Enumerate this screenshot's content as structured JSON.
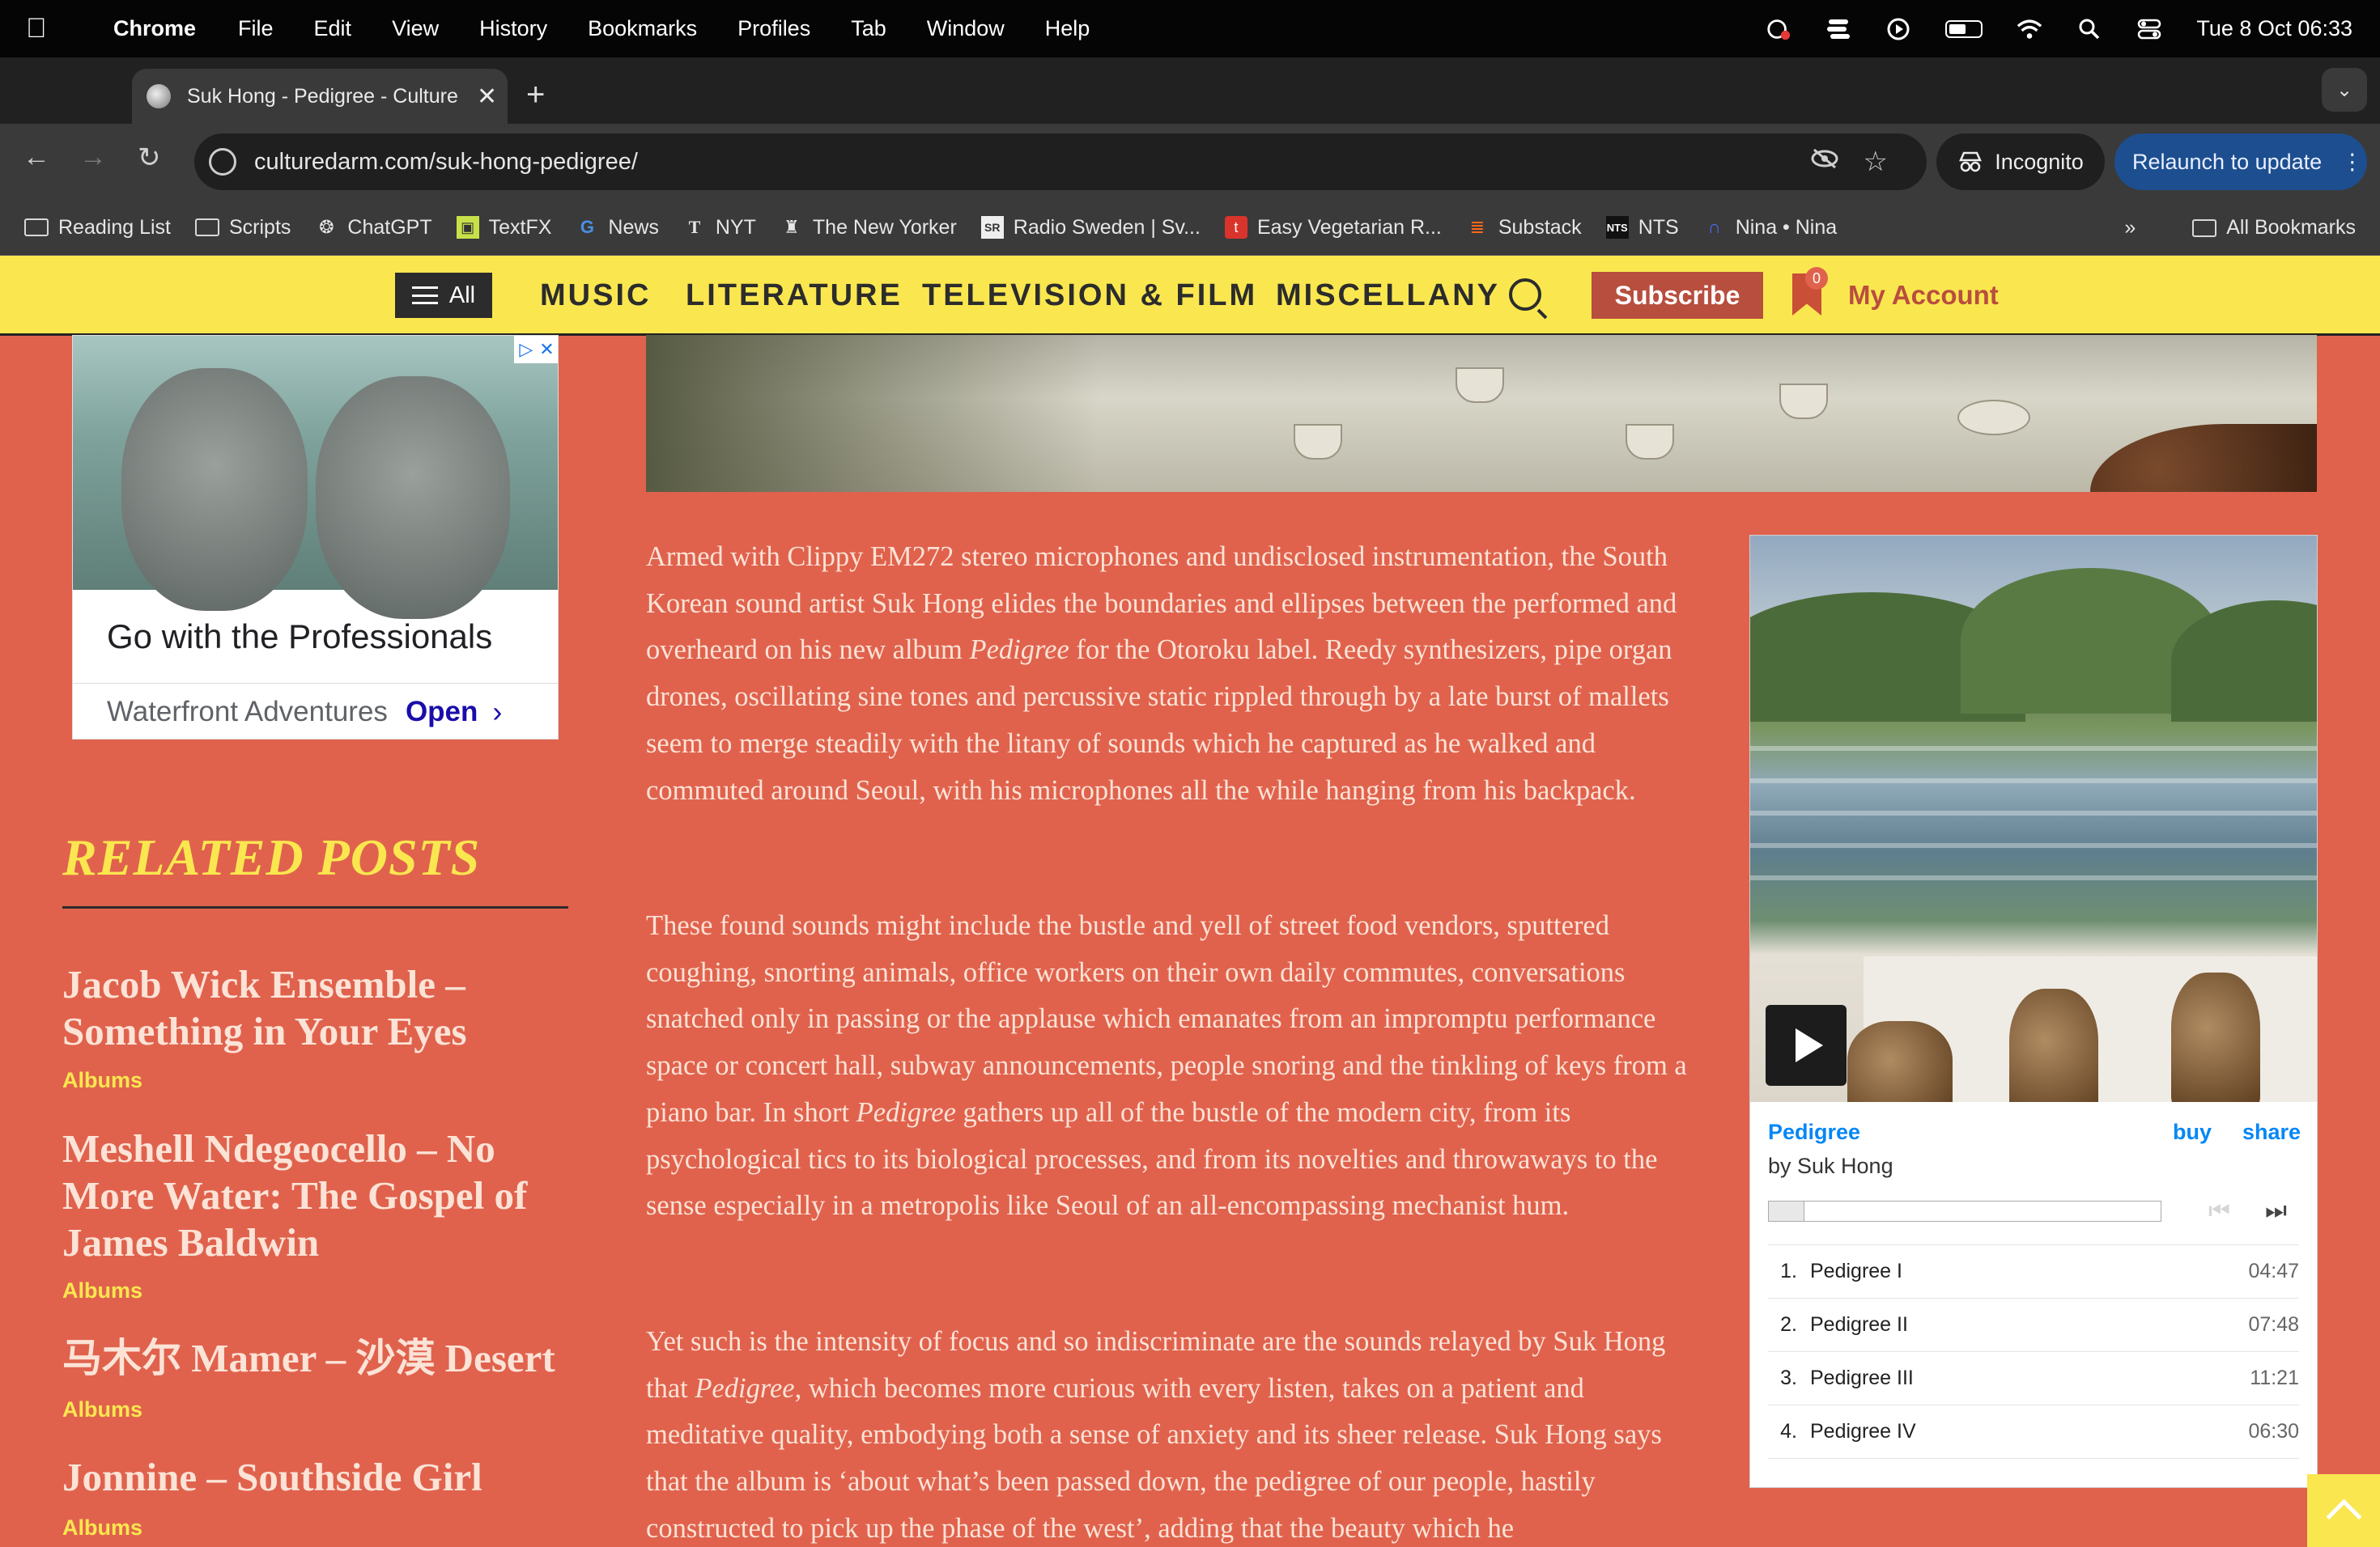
{
  "menubar": {
    "app": "Chrome",
    "items": [
      "File",
      "Edit",
      "View",
      "History",
      "Bookmarks",
      "Profiles",
      "Tab",
      "Window",
      "Help"
    ],
    "clock": "Tue 8 Oct  06:33"
  },
  "tab": {
    "title": "Suk Hong - Pedigree - Culture Dar",
    "new_tab": "+"
  },
  "toolbar": {
    "url": "culturedarm.com/suk-hong-pedigree/",
    "incognito": "Incognito",
    "relaunch": "Relaunch to update"
  },
  "bookmarks": {
    "items": [
      {
        "label": "Reading List",
        "icon": "folder-icon"
      },
      {
        "label": "Scripts",
        "icon": "folder-icon"
      },
      {
        "label": "ChatGPT",
        "icon": "chatgpt-icon"
      },
      {
        "label": "TextFX",
        "icon": "textfx-icon"
      },
      {
        "label": "News",
        "icon": "google-icon"
      },
      {
        "label": "NYT",
        "icon": "nyt-icon"
      },
      {
        "label": "The New Yorker",
        "icon": "new-yorker-icon"
      },
      {
        "label": "Radio Sweden | Sv...",
        "icon": "sr-icon"
      },
      {
        "label": "Easy Vegetarian R...",
        "icon": "recipe-icon"
      },
      {
        "label": "Substack",
        "icon": "substack-icon"
      },
      {
        "label": "NTS",
        "icon": "nts-icon"
      },
      {
        "label": "Nina • Nina",
        "icon": "nina-icon"
      }
    ],
    "more": "»",
    "all": "All Bookmarks"
  },
  "sitenav": {
    "all": "All",
    "links": [
      "MUSIC",
      "LITERATURE",
      "TELEVISION & FILM",
      "MISCELLANY"
    ],
    "subscribe": "Subscribe",
    "badge": "0",
    "account": "My Account"
  },
  "ad": {
    "headline": "Go with the Professionals",
    "advertiser": "Waterfront Adventures",
    "cta": "Open"
  },
  "related": {
    "heading": "RELATED POSTS",
    "posts": [
      {
        "title": "Jacob Wick Ensemble – Something in Your Eyes",
        "category": "Albums"
      },
      {
        "title": "Meshell Ndegeocello – No More Water: The Gospel of James Baldwin",
        "category": "Albums"
      },
      {
        "title": "马木尔 Mamer – 沙漠 Desert",
        "category": "Albums"
      },
      {
        "title": "Jonnine – Southside Girl",
        "category": "Albums"
      }
    ]
  },
  "article": {
    "p1": [
      "Armed with Clippy EM272 stereo microphones and undisclosed instrumentation, the South Korean sound artist Suk Hong elides the boundaries and ellipses between the performed and overheard on his new album ",
      "Pedigree",
      " for the Otoroku label. Reedy synthesizers, pipe organ drones, oscillating sine tones and percussive static rippled through by a late burst of mallets seem to merge steadily with the litany of sounds which he captured as he walked and commuted around Seoul, with his microphones all the while hanging from his backpack."
    ],
    "p2": [
      "These found sounds might include the bustle and yell of street food vendors, sputtered coughing, snorting animals, office workers on their own daily commutes, conversations snatched only in passing or the applause which emanates from an impromptu performance space or concert hall, subway announcements, people snoring and the tinkling of keys from a piano bar. In short ",
      "Pedigree",
      " gathers up all of the bustle of the modern city, from its psychological tics to its biological processes, and from its novelties and throwaways to the sense especially in a metropolis like Seoul of an all-encompassing mechanist hum."
    ],
    "p3": [
      "Yet such is the intensity of focus and so indiscriminate are the sounds relayed by Suk Hong that ",
      "Pedigree",
      ", which becomes more curious with every listen, takes on a patient and meditative quality, embodying both a sense of anxiety and its sheer release. Suk Hong says that the album is ‘about what’s been passed down, the pedigree of our people, hastily constructed to pick up the phase of the west’, adding that the beauty which he"
    ]
  },
  "player": {
    "album": "Pedigree",
    "artist": "by Suk Hong",
    "buy": "buy",
    "share": "share",
    "progress": 0.09,
    "tracks": [
      {
        "num": "1.",
        "title": "Pedigree I",
        "duration": "04:47"
      },
      {
        "num": "2.",
        "title": "Pedigree II",
        "duration": "07:48"
      },
      {
        "num": "3.",
        "title": "Pedigree III",
        "duration": "11:21"
      },
      {
        "num": "4.",
        "title": "Pedigree IV",
        "duration": "06:30"
      }
    ]
  }
}
